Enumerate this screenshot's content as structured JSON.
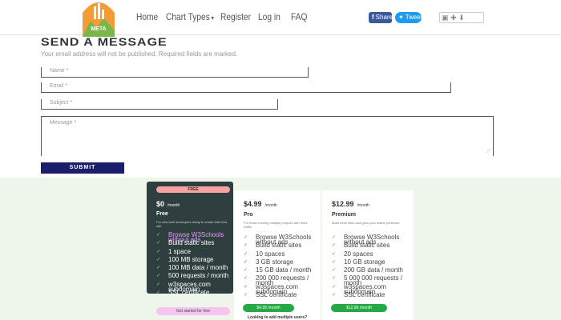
{
  "nav": {
    "logo_text": "META",
    "links": [
      "Home",
      "Chart Types",
      "Register",
      "Log in",
      "FAQ"
    ],
    "share": {
      "facebook": "Share",
      "twitter": "Tweet"
    },
    "colors": {
      "logo_orange": "#f39c35",
      "logo_green": "#78b84a",
      "facebook": "#3b5998",
      "twitter": "#1d9bf0"
    }
  },
  "form": {
    "title": "SEND A MESSAGE",
    "note": "Your email address will not be published. Required fields are marked.",
    "fields": {
      "name": "Name *",
      "email": "Email *",
      "subject": "Subject *",
      "message": "Message *"
    },
    "submit_label": "SUBMIT",
    "submit_color": "#1b1f6b"
  },
  "pricing": {
    "background": "#eef5e9",
    "plans": [
      {
        "badge": "FREE",
        "price": "$0",
        "period": "/month",
        "name": "Free",
        "description": "For new web developers ready to create their first site.",
        "features": [
          "Browse W3Schools without ads",
          "Build static sites",
          "1 space",
          "100 MB storage",
          "100 MB data / month",
          "500 requests / month",
          "w3spaces.com subdomain",
          "SSL certificate"
        ],
        "cta": "Get started for free"
      },
      {
        "price": "$4.99",
        "period": "/month",
        "name": "Pro",
        "description": "For those running multiple projects with more traffic.",
        "features": [
          "Browse W3Schools without ads",
          "Build static sites",
          "10 spaces",
          "3 GB storage",
          "15 GB data / month",
          "200 000 requests / month",
          "w3spaces.com subdomain",
          "SSL certificate"
        ],
        "cta": "$4.99 /month",
        "note": "Looking to add multiple users?"
      },
      {
        "price": "$12.99",
        "period": "/month",
        "name": "Premium",
        "description": "Build more sites and grow your online presence.",
        "features": [
          "Browse W3Schools without ads",
          "Build static sites",
          "20 spaces",
          "10 GB storage",
          "200 GB data / month",
          "5 000 000 requests / month",
          "w3spaces.com subdomain",
          "SSL certificate"
        ],
        "cta": "$12.99 /month"
      }
    ]
  }
}
